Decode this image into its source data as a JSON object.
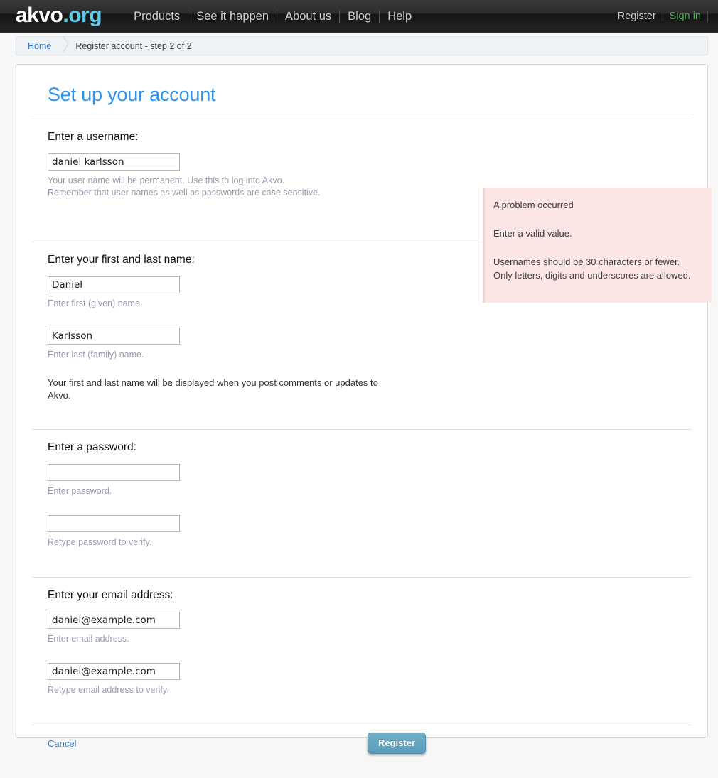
{
  "header": {
    "logo": {
      "primary": "akvo",
      "suffix": ".org"
    },
    "nav": [
      {
        "label": "Products"
      },
      {
        "label": "See it happen"
      },
      {
        "label": "About us"
      },
      {
        "label": "Blog"
      },
      {
        "label": "Help"
      }
    ],
    "user_nav": {
      "register": "Register",
      "signin": "Sign in",
      "signin_color": "#4caf50"
    }
  },
  "breadcrumb": {
    "home": "Home",
    "current": "Register account - step 2 of 2"
  },
  "page": {
    "title": "Set up your account",
    "title_color": "#2b94f0"
  },
  "username_section": {
    "legend": "Enter a username:",
    "value": "daniel karlsson",
    "help_line1": "Your user name will be permanent. Use this to log into Akvo.",
    "help_line2": "Remember that user names as well as passwords are case sensitive."
  },
  "error_panel": {
    "title": "A problem occurred",
    "message": "Enter a valid value.",
    "detail_line1": "Usernames should be 30 characters or fewer.",
    "detail_line2": "Only letters, digits and underscores are allowed.",
    "background": "#fce5e5"
  },
  "name_section": {
    "legend": "Enter your first and last name:",
    "first_value": "Daniel",
    "first_help": "Enter first (given) name.",
    "last_value": "Karlsson",
    "last_help": "Enter last (family) name.",
    "note": "Your first and last name will be displayed when you post comments or updates to Akvo."
  },
  "password_section": {
    "legend": "Enter a password:",
    "password_value": "",
    "password_help": "Enter password.",
    "confirm_value": "",
    "confirm_help": "Retype password to verify."
  },
  "email_section": {
    "legend": "Enter your email address:",
    "email_value": "daniel@example.com",
    "email_help": "Enter email address.",
    "confirm_value": "daniel@example.com",
    "confirm_help": "Retype email address to verify."
  },
  "footer": {
    "cancel_label": "Cancel",
    "register_label": "Register",
    "register_color": "#5a9cb9"
  }
}
